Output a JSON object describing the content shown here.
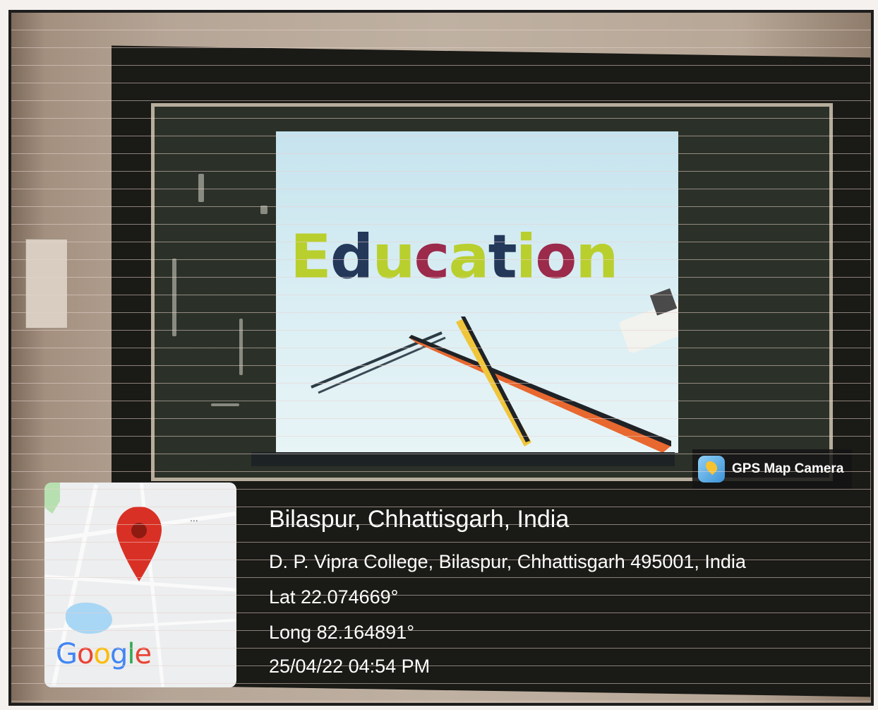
{
  "slide": {
    "word": "Education",
    "letters": [
      {
        "char": "E",
        "color": "g"
      },
      {
        "char": "d",
        "color": "n"
      },
      {
        "char": "u",
        "color": "g"
      },
      {
        "char": "c",
        "color": "r"
      },
      {
        "char": "a",
        "color": "g"
      },
      {
        "char": "t",
        "color": "n"
      },
      {
        "char": "i",
        "color": "g"
      },
      {
        "char": "o",
        "color": "r"
      },
      {
        "char": "n",
        "color": "g"
      }
    ]
  },
  "badge": {
    "label": "GPS Map Camera",
    "icon": "gps-map-camera-app-icon"
  },
  "map": {
    "brand": "Google",
    "menu_glyph": "...",
    "pin_icon": "map-pin-icon",
    "pin_color": "#d93025"
  },
  "location": {
    "place": "Bilaspur, Chhattisgarh, India",
    "address": "D. P. Vipra College, Bilaspur, Chhattisgarh 495001, India",
    "latitude": "Lat 22.074669°",
    "longitude": "Long 82.164891°",
    "datetime": "25/04/22 04:54 PM"
  }
}
